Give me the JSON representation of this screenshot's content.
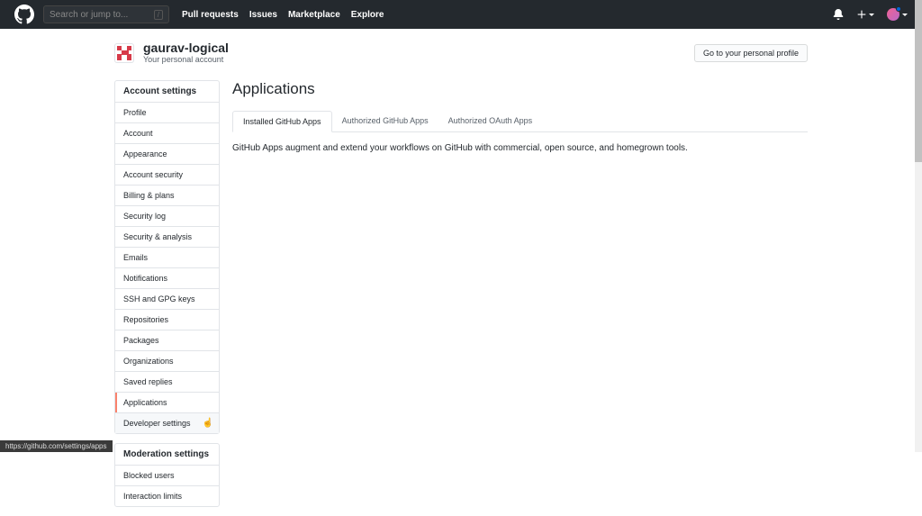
{
  "header": {
    "search_placeholder": "Search or jump to...",
    "nav": [
      "Pull requests",
      "Issues",
      "Marketplace",
      "Explore"
    ]
  },
  "profile": {
    "username": "gaurav-logical",
    "account_type": "Your personal account",
    "go_profile_btn": "Go to your personal profile"
  },
  "sidebar": {
    "sections": [
      {
        "title": "Account settings",
        "items": [
          "Profile",
          "Account",
          "Appearance",
          "Account security",
          "Billing & plans",
          "Security log",
          "Security & analysis",
          "Emails",
          "Notifications",
          "SSH and GPG keys",
          "Repositories",
          "Packages",
          "Organizations",
          "Saved replies",
          "Applications",
          "Developer settings"
        ]
      },
      {
        "title": "Moderation settings",
        "items": [
          "Blocked users",
          "Interaction limits"
        ]
      }
    ],
    "active_item": "Applications",
    "hover_item": "Developer settings"
  },
  "main": {
    "title": "Applications",
    "tabs": [
      "Installed GitHub Apps",
      "Authorized GitHub Apps",
      "Authorized OAuth Apps"
    ],
    "active_tab": "Installed GitHub Apps",
    "description": "GitHub Apps augment and extend your workflows on GitHub with commercial, open source, and homegrown tools."
  },
  "status_bar": "https://github.com/settings/apps"
}
